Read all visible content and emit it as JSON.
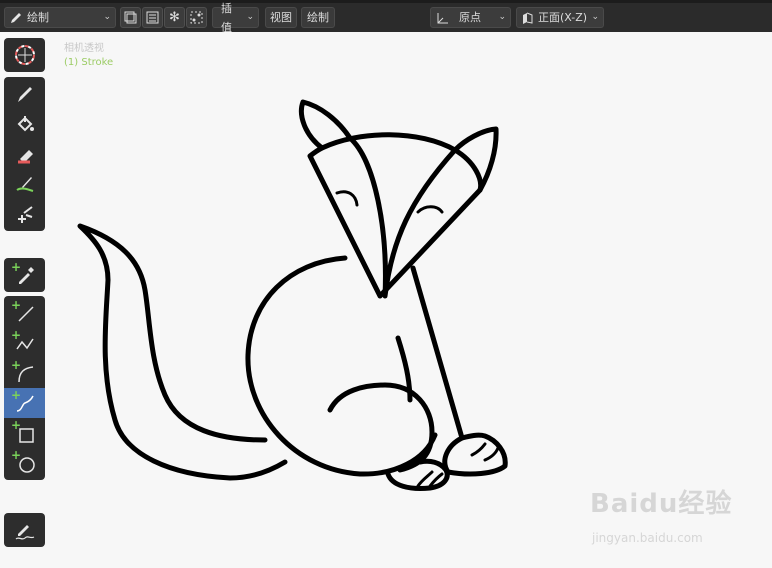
{
  "header": {
    "mode_label": "绘制",
    "interpolate_label": "插值",
    "view_label": "视图",
    "draw_label": "绘制",
    "origin_label": "原点",
    "orientation_label": "正面(X-Z)"
  },
  "viewport": {
    "camera_label": "相机透视",
    "object_label": "(1) Stroke"
  },
  "watermark": {
    "brand": "Baidu经验",
    "url": "jingyan.baidu.com"
  },
  "colors": {
    "header_bg": "#2b2b2b",
    "toolbar_bg": "#2d2d2d",
    "active_tool": "#4772b3",
    "canvas_bg": "#f7f7f7",
    "stroke": "#000000",
    "add_plus": "#7bd35a"
  },
  "tools": [
    "cursor-tool",
    "draw-tool",
    "fill-tool",
    "erase-tool",
    "tint-tool",
    "cutter-tool",
    "eyedropper-tool",
    "line-tool",
    "polyline-tool",
    "arc-tool",
    "curve-tool",
    "box-tool",
    "circle-tool",
    "annotate-tool"
  ],
  "active_tool": "curve-tool"
}
